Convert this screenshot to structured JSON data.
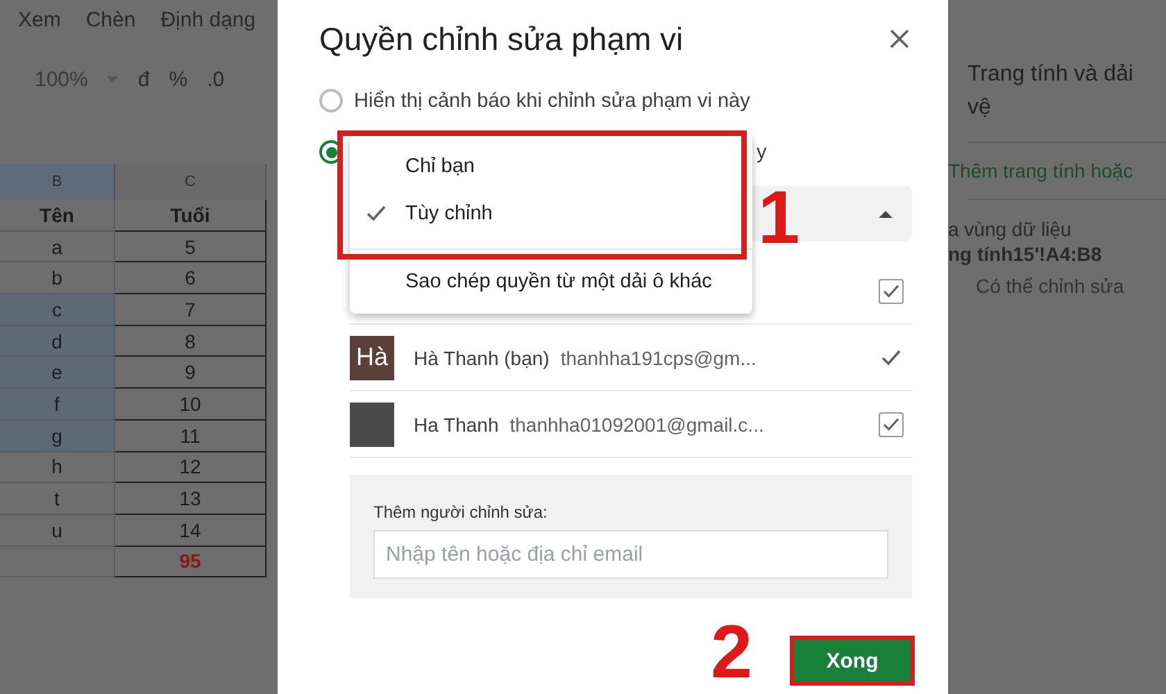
{
  "spreadsheet": {
    "menu": [
      "Xem",
      "Chèn",
      "Định dạng"
    ],
    "toolbar": {
      "zoom": "100%",
      "items": [
        "đ",
        "%",
        ".0"
      ]
    },
    "columns": [
      {
        "label": "B",
        "selected": true
      },
      {
        "label": "C",
        "selected": false
      }
    ],
    "rows": [
      {
        "name": "Tên",
        "age": "Tuổi",
        "kind": "header",
        "selected": false
      },
      {
        "name": "a",
        "age": "5",
        "kind": "data",
        "selected": false
      },
      {
        "name": "b",
        "age": "6",
        "kind": "data",
        "selected": false
      },
      {
        "name": "c",
        "age": "7",
        "kind": "data",
        "selected": true
      },
      {
        "name": "d",
        "age": "8",
        "kind": "data",
        "selected": true
      },
      {
        "name": "e",
        "age": "9",
        "kind": "data",
        "selected": true
      },
      {
        "name": "f",
        "age": "10",
        "kind": "data",
        "selected": true
      },
      {
        "name": "g",
        "age": "11",
        "kind": "data",
        "selected": true
      },
      {
        "name": "h",
        "age": "12",
        "kind": "data",
        "selected": false
      },
      {
        "name": "t",
        "age": "13",
        "kind": "data",
        "selected": false
      },
      {
        "name": "u",
        "age": "14",
        "kind": "data",
        "selected": false
      },
      {
        "name": "",
        "age": "95",
        "kind": "total",
        "selected": false
      }
    ]
  },
  "dialog": {
    "title": "Quyền chỉnh sửa phạm vi",
    "options": [
      {
        "label": "Hiển thị cảnh báo khi chỉnh sửa phạm vi này",
        "selected": false
      },
      {
        "label": "y",
        "selected": true
      }
    ],
    "select": {
      "expanded": true
    },
    "menu": [
      {
        "label": "Chỉ bạn",
        "checked": false,
        "kind": "option"
      },
      {
        "label": "Tùy chỉnh",
        "checked": true,
        "kind": "option"
      },
      {
        "label": "Sao chép quyền từ một dải ô khác",
        "checked": false,
        "kind": "action"
      }
    ],
    "people": [
      {
        "kind": "checkbox",
        "checked": true
      },
      {
        "kind": "tick",
        "checked": true,
        "avatar": {
          "kind": "letters",
          "text": "Hà"
        },
        "name": "Hà Thanh (bạn)",
        "email": "thanhha191cps@gm..."
      },
      {
        "kind": "checkbox",
        "checked": true,
        "avatar": {
          "kind": "photo"
        },
        "name": "Ha Thanh",
        "email": "thanhha01092001@gmail.c..."
      }
    ],
    "add_editor": {
      "label": "Thêm người chỉnh sửa:",
      "placeholder": "Nhập tên hoặc địa chỉ email"
    },
    "done_button": "Xong",
    "annotations": [
      {
        "label": "1",
        "kind": "menu"
      },
      {
        "label": "2",
        "kind": "button"
      }
    ]
  },
  "side_panel": {
    "title_lines": [
      "Trang tính và dải",
      "vệ"
    ],
    "add_link": "Thêm trang tính hoặc",
    "range": {
      "lines": [
        "a vùng dữ liệu",
        "ng tính15'!A4:B8"
      ],
      "permission": "Có thể chỉnh sửa"
    }
  }
}
